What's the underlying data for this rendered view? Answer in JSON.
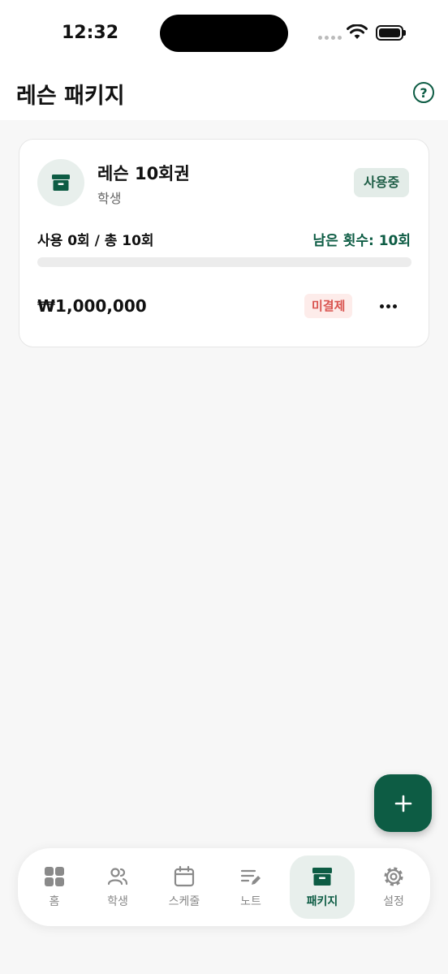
{
  "status_bar": {
    "time": "12:32"
  },
  "header": {
    "title": "레슨 패키지",
    "help_icon": "help-circle-icon",
    "help_glyph": "?"
  },
  "package_card": {
    "name": "레슨 10회권",
    "student": "학생",
    "status": "사용중",
    "usage": "사용 0회 / 총 10회",
    "remaining": "남은 횟수: 10회",
    "progress_fraction": 0,
    "price": "₩1,000,000",
    "payment_status": "미결제"
  },
  "fab": {
    "icon": "plus-icon"
  },
  "tabbar": {
    "items": [
      {
        "label": "홈",
        "icon": "grid-icon",
        "active": false
      },
      {
        "label": "학생",
        "icon": "users-icon",
        "active": false
      },
      {
        "label": "스케줄",
        "icon": "calendar-icon",
        "active": false
      },
      {
        "label": "노트",
        "icon": "note-edit-icon",
        "active": false
      },
      {
        "label": "패키지",
        "icon": "archive-box-icon",
        "active": true
      },
      {
        "label": "설정",
        "icon": "gear-icon",
        "active": false
      }
    ]
  },
  "colors": {
    "accent": "#0d5c44",
    "background": "#f7f7f7",
    "unpaid": "#d9534f"
  }
}
